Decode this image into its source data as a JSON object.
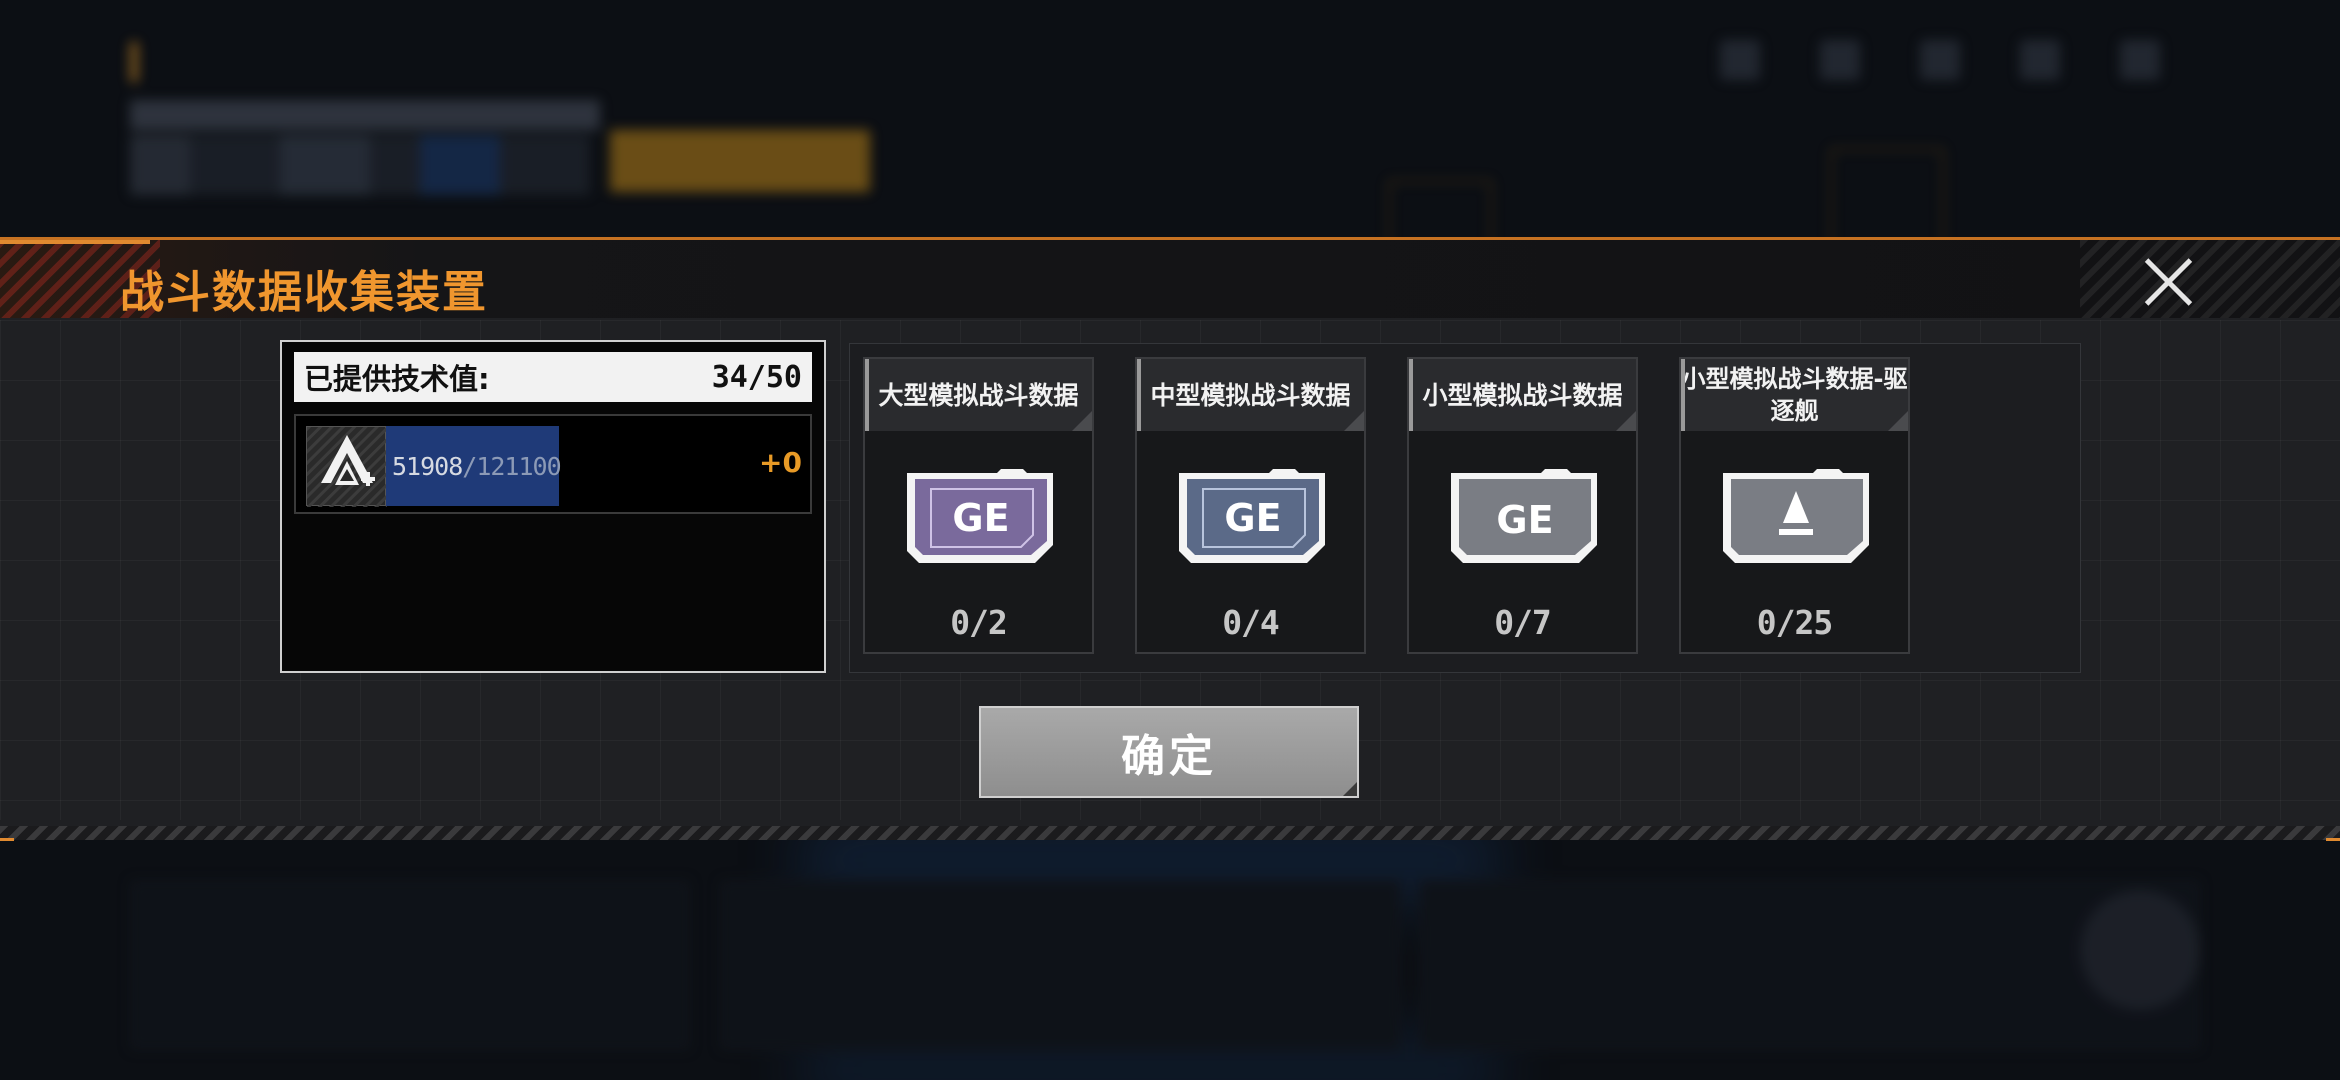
{
  "modal": {
    "title": "战斗数据收集装置"
  },
  "tech": {
    "label": "已提供技术值:",
    "value": "34/50",
    "progress_current": "51908",
    "progress_max": "/121100",
    "progress_fraction": 0.4286,
    "bonus": "+0"
  },
  "slots": [
    {
      "name": "大型模拟战斗数据",
      "count": "0/2",
      "card_color": "#7a6a9c",
      "card_label": "GE",
      "icon": "ge-card-large-icon"
    },
    {
      "name": "中型模拟战斗数据",
      "count": "0/4",
      "card_color": "#5b6a88",
      "card_label": "GE",
      "icon": "ge-card-medium-icon"
    },
    {
      "name": "小型模拟战斗数据",
      "count": "0/7",
      "card_color": "#7a7d84",
      "card_label": "GE",
      "icon": "ge-card-small-icon"
    },
    {
      "name": "小型模拟战斗数据-驱逐舰",
      "count": "0/25",
      "card_color": "#7a7d84",
      "icon": "destroyer-card-icon"
    }
  ],
  "confirm_label": "确定",
  "colors": {
    "accent": "#f0962e",
    "progress_fill": "#1f3a78"
  }
}
